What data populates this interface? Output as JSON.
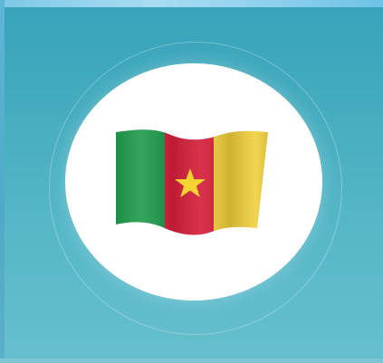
{
  "colors": {
    "background": "#4aa9bd",
    "disc": "#ffffff",
    "flag_green": "#1e9a4b",
    "flag_red": "#d51f3a",
    "flag_yellow": "#f0cf3a",
    "flag_star": "#f5d330"
  },
  "icons": {
    "flag": "cameroon-flag-icon",
    "star": "star-icon"
  }
}
